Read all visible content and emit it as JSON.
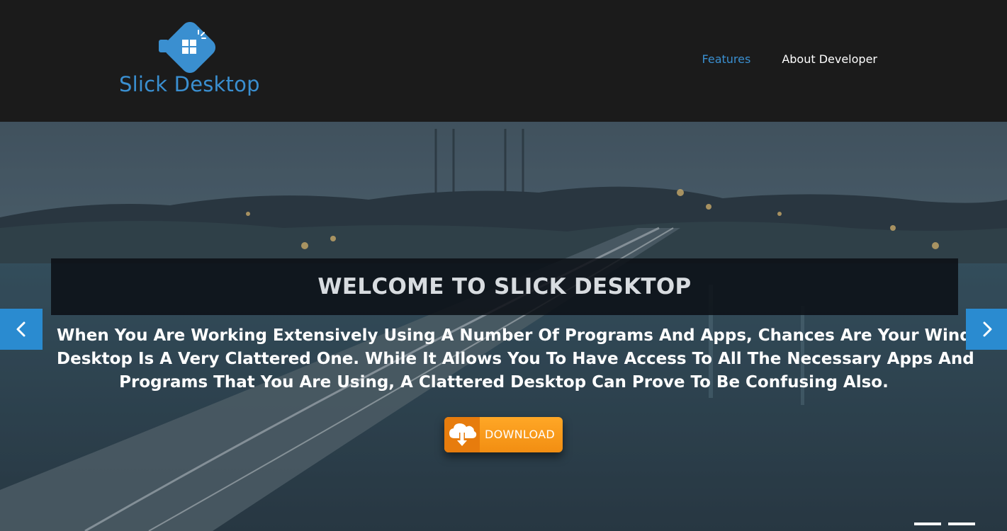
{
  "brand": {
    "name": "Slick Desktop",
    "color": "#3a8fd0"
  },
  "nav": {
    "items": [
      {
        "label": "Features",
        "active": true
      },
      {
        "label": "About Developer",
        "active": false
      }
    ]
  },
  "hero": {
    "title": "WELCOME TO SLICK DESKTOP",
    "description_lines": [
      "When You Are Working Extensively Using A Number Of Programs And Apps, Chances Are Your Windows",
      "Desktop Is A Very Clattered One. While It Allows You To Have Access To All The Necessary Apps And",
      "Programs That You Are Using, A Clattered Desktop Can Prove To Be Confusing Also."
    ],
    "download_label": "DOWNLOAD",
    "download_icon": "cloud-download-icon",
    "prev_icon": "chevron-left-icon",
    "next_icon": "chevron-right-icon",
    "slide_count": 2,
    "accent_color": "#2a8bd0",
    "button_color": "#f28e12"
  }
}
